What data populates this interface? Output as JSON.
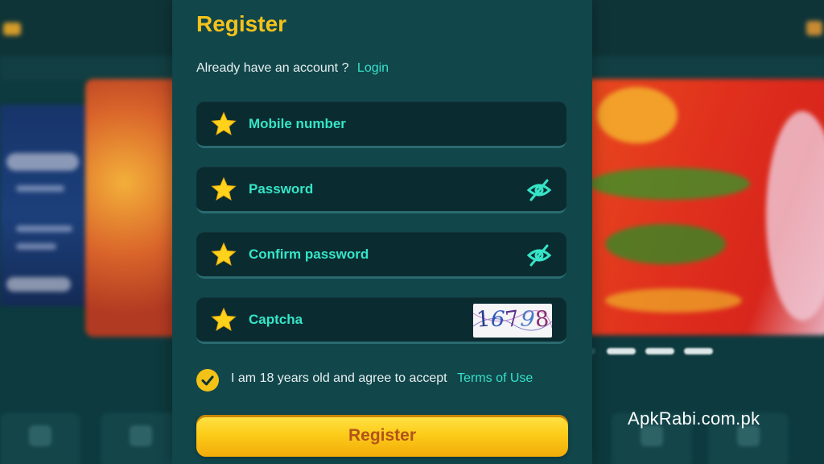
{
  "form": {
    "title": "Register",
    "account_prompt": "Already have an account ?",
    "login_link": "Login",
    "fields": [
      {
        "label": "Mobile number",
        "icon": "star-icon"
      },
      {
        "label": "Password",
        "icon": "star-icon",
        "toggle_icon": "eye-off-icon"
      },
      {
        "label": "Confirm password",
        "icon": "star-icon",
        "toggle_icon": "eye-off-icon"
      },
      {
        "label": "Captcha",
        "icon": "star-icon",
        "captcha_value": "16798"
      }
    ],
    "agreement_text": "I am 18 years old and agree to accept",
    "agreement_checked": true,
    "terms_link": "Terms of Use",
    "submit_label": "Register"
  },
  "watermark": "ApkRabi.com.pk",
  "colors": {
    "accent_yellow": "#f4c21a",
    "label_teal": "#36e5c7",
    "panel_bg": "#11464b",
    "field_bg": "#0a2c31"
  }
}
